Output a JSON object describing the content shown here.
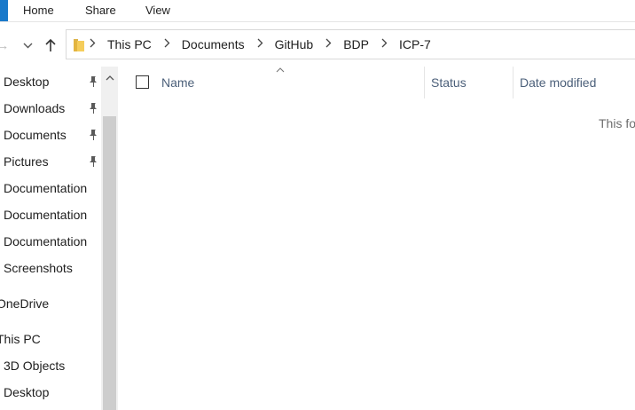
{
  "ribbon": {
    "tabs": [
      "Home",
      "Share",
      "View"
    ]
  },
  "address": {
    "crumbs": [
      "This PC",
      "Documents",
      "GitHub",
      "BDP",
      "ICP-7"
    ]
  },
  "sidebar": {
    "items": [
      {
        "label": "Desktop",
        "pinned": true
      },
      {
        "label": "Downloads",
        "pinned": true
      },
      {
        "label": "Documents",
        "pinned": true
      },
      {
        "label": "Pictures",
        "pinned": true
      },
      {
        "label": "Documentation",
        "pinned": false
      },
      {
        "label": "Documentation",
        "pinned": false
      },
      {
        "label": "Documentation",
        "pinned": false
      },
      {
        "label": "Screenshots",
        "pinned": false
      },
      {
        "label": "OneDrive",
        "pinned": false
      },
      {
        "label": "This PC",
        "pinned": false
      },
      {
        "label": "3D Objects",
        "pinned": false
      },
      {
        "label": "Desktop",
        "pinned": false
      }
    ]
  },
  "columns": {
    "name": "Name",
    "status": "Status",
    "date_modified": "Date modified"
  },
  "content": {
    "empty_text": "This fo"
  },
  "colors": {
    "accent": "#1979ca",
    "column_header": "#4c607a"
  }
}
